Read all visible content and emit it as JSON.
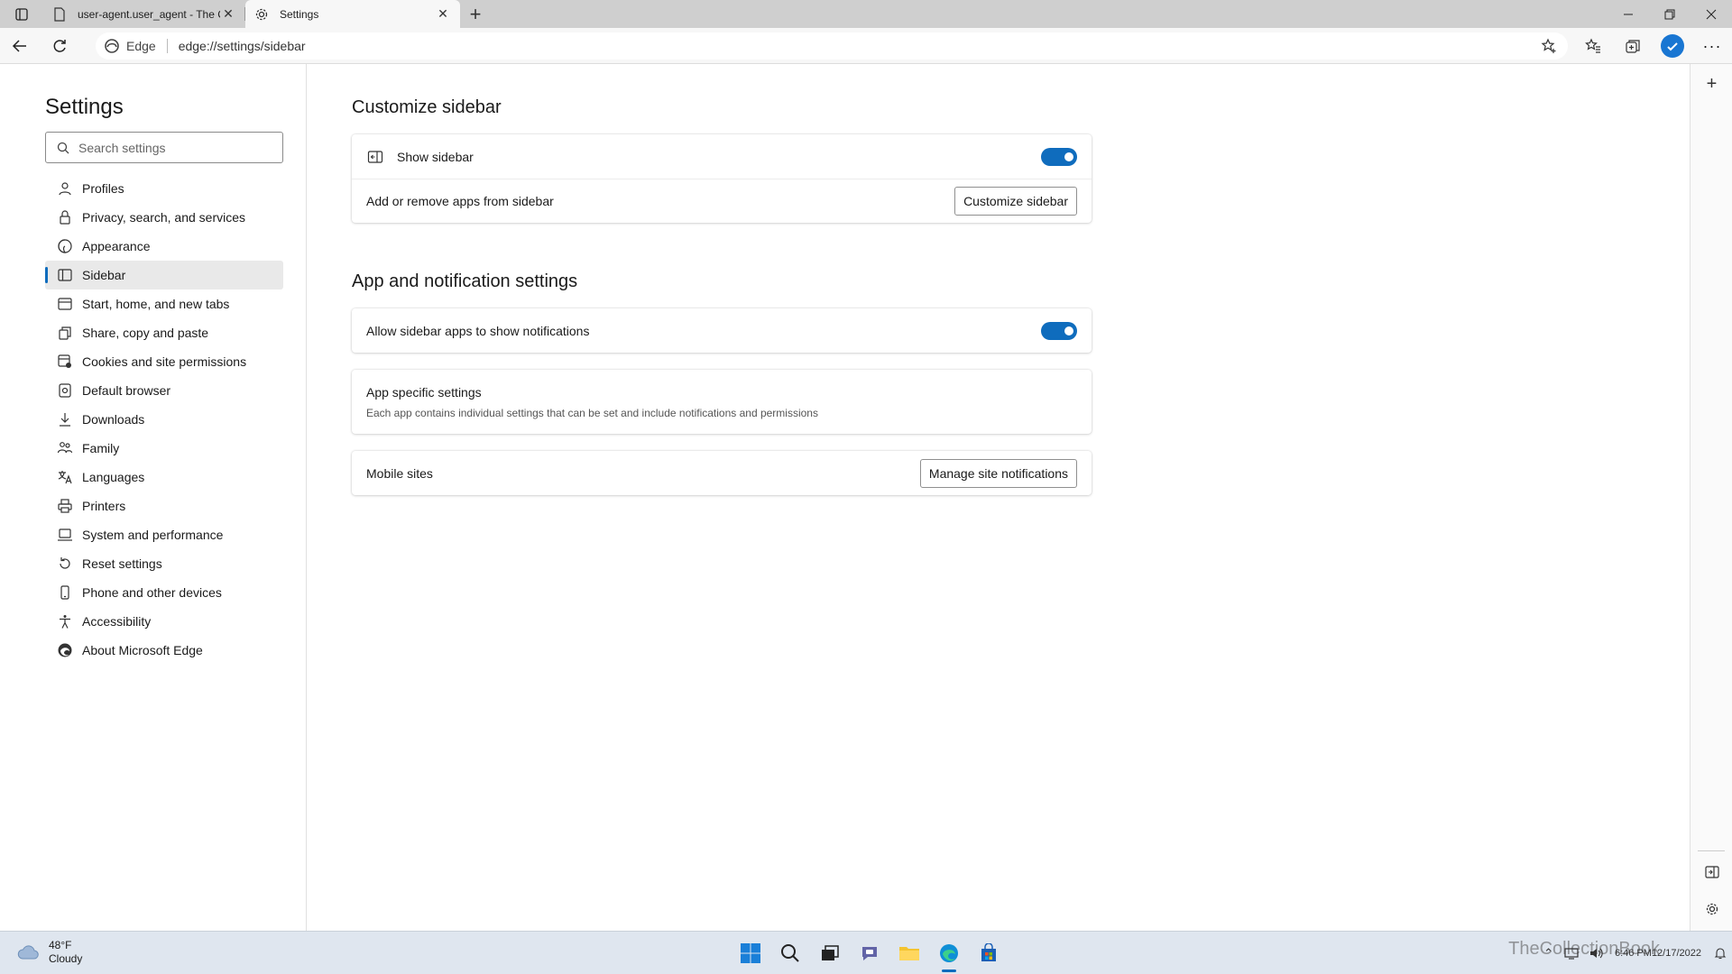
{
  "tabs": [
    {
      "title": "user-agent.user_agent - The Coll",
      "active": false
    },
    {
      "title": "Settings",
      "active": true
    }
  ],
  "address": {
    "badge": "Edge",
    "url": "edge://settings/sidebar"
  },
  "leftnav": {
    "title": "Settings",
    "search_placeholder": "Search settings",
    "items": [
      {
        "label": "Profiles",
        "icon": "profile-icon"
      },
      {
        "label": "Privacy, search, and services",
        "icon": "lock-icon"
      },
      {
        "label": "Appearance",
        "icon": "appearance-icon"
      },
      {
        "label": "Sidebar",
        "icon": "sidebar-icon",
        "selected": true
      },
      {
        "label": "Start, home, and new tabs",
        "icon": "home-icon"
      },
      {
        "label": "Share, copy and paste",
        "icon": "share-icon"
      },
      {
        "label": "Cookies and site permissions",
        "icon": "cookies-icon"
      },
      {
        "label": "Default browser",
        "icon": "browser-icon"
      },
      {
        "label": "Downloads",
        "icon": "download-icon"
      },
      {
        "label": "Family",
        "icon": "family-icon"
      },
      {
        "label": "Languages",
        "icon": "languages-icon"
      },
      {
        "label": "Printers",
        "icon": "printer-icon"
      },
      {
        "label": "System and performance",
        "icon": "system-icon"
      },
      {
        "label": "Reset settings",
        "icon": "reset-icon"
      },
      {
        "label": "Phone and other devices",
        "icon": "phone-icon"
      },
      {
        "label": "Accessibility",
        "icon": "accessibility-icon"
      },
      {
        "label": "About Microsoft Edge",
        "icon": "edge-logo-icon"
      }
    ]
  },
  "main": {
    "customize": {
      "title": "Customize sidebar",
      "show_sidebar_label": "Show sidebar",
      "show_sidebar_on": true,
      "apps_label": "Add or remove apps from sidebar",
      "customize_button": "Customize sidebar"
    },
    "notifications": {
      "title": "App and notification settings",
      "allow_label": "Allow sidebar apps to show notifications",
      "allow_on": true,
      "app_specific_title": "App specific settings",
      "app_specific_desc": "Each app contains individual settings that can be set and include notifications and permissions",
      "mobile_sites_label": "Mobile sites",
      "manage_button": "Manage site notifications"
    }
  },
  "taskbar": {
    "weather_temp": "48°F",
    "weather_cond": "Cloudy",
    "time": "6:46 PM",
    "date": "12/17/2022",
    "watermark": "TheCollectionBook"
  },
  "colors": {
    "accent": "#0f6cbd",
    "taskbar": "#dfe6ef"
  }
}
